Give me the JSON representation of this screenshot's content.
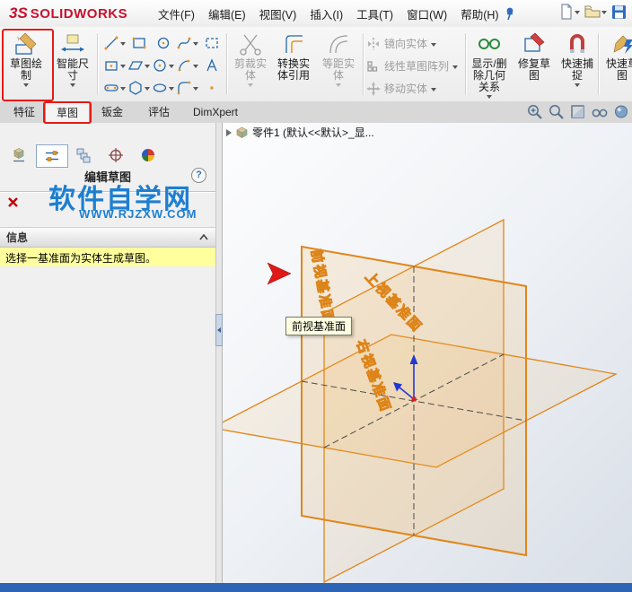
{
  "titlebar": {
    "logo_mark": "3S",
    "logo_text": "SOLIDWORKS",
    "menus": [
      "文件(F)",
      "编辑(E)",
      "视图(V)",
      "插入(I)",
      "工具(T)",
      "窗口(W)",
      "帮助(H)"
    ]
  },
  "ribbon": {
    "sketch": "草图绘制",
    "smart_dimension": "智能尺寸",
    "trim": "剪裁实体",
    "convert_entities": "转换实体引用",
    "offset_entities": "等距实体",
    "mirror_entities": "镜向实体",
    "linear_pattern": "线性草图阵列",
    "move_entities": "移动实体",
    "display_delete_relations": "显示/删除几何关系",
    "repair_sketch": "修复草图",
    "quick_snaps": "快速捕捉",
    "rapid_sketch": "快速草图"
  },
  "tabs": {
    "items": [
      "特征",
      "草图",
      "钣金",
      "评估",
      "DimXpert"
    ],
    "active": "草图"
  },
  "property_panel": {
    "title": "编辑草图",
    "help": "?",
    "info_header": "信息",
    "message": "选择一基准面为实体生成草图。"
  },
  "watermark": {
    "title": "软件自学网",
    "url": "WWW.RJZXW.COM"
  },
  "viewport": {
    "feature_tree_item": "零件1 (默认<<默认>_显...",
    "tooltip": "前视基准面",
    "front_plane": "前视基准面",
    "top_plane": "上视基准面",
    "right_plane": "右视基准面"
  },
  "colors": {
    "accent_red": "#e41b17",
    "plane_orange": "#dd8418",
    "watermark_blue": "#1d7fd1",
    "highlight_yellow": "#ffff9e",
    "statusbar_blue": "#2e64b5"
  }
}
